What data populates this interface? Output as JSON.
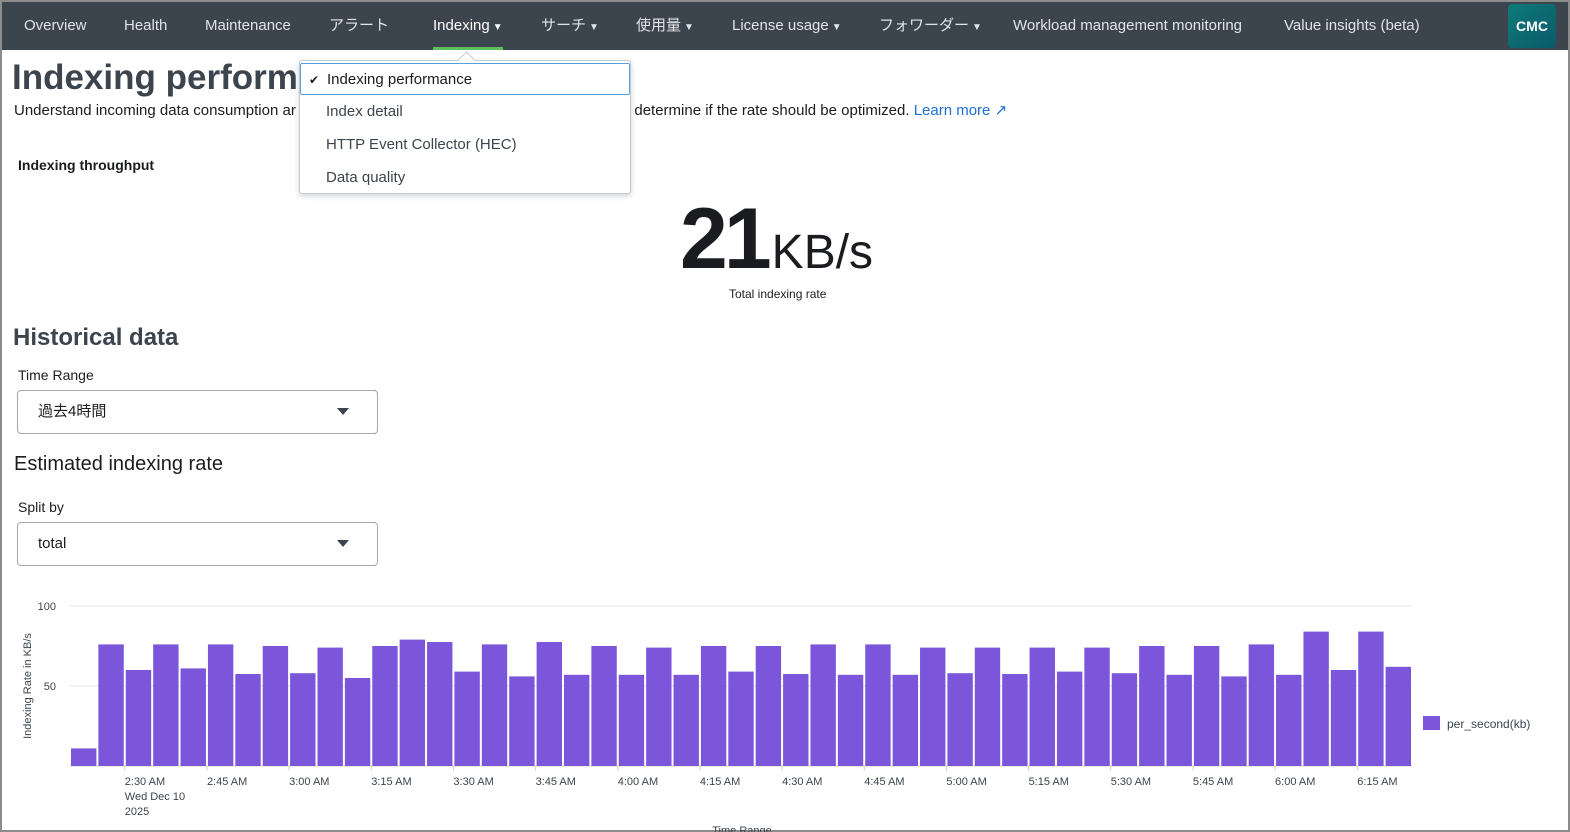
{
  "nav": {
    "items": [
      {
        "label": "Overview",
        "dropdown": false
      },
      {
        "label": "Health",
        "dropdown": false
      },
      {
        "label": "Maintenance",
        "dropdown": false
      },
      {
        "label": "アラート",
        "dropdown": false
      },
      {
        "label": "Indexing",
        "dropdown": true,
        "active": true
      },
      {
        "label": "サーチ",
        "dropdown": true
      },
      {
        "label": "使用量",
        "dropdown": true
      },
      {
        "label": "License usage",
        "dropdown": true
      },
      {
        "label": "フォワーダー",
        "dropdown": true
      },
      {
        "label": "Workload management monitoring",
        "dropdown": false
      },
      {
        "label": "Value insights (beta)",
        "dropdown": false
      }
    ],
    "logo": "CMC"
  },
  "menu": {
    "items": [
      "Indexing performance",
      "Index detail",
      "HTTP Event Collector (HEC)",
      "Data quality"
    ],
    "selected": "Indexing performance"
  },
  "page": {
    "title": "Indexing performance",
    "desc_start": "Understand incoming data consumption ar",
    "desc_end": "o determine if the rate should be optimized.",
    "learn_more": "Learn more"
  },
  "throughput": {
    "label": "Indexing throughput",
    "value": "21",
    "unit": "KB/s",
    "caption": "Total indexing rate"
  },
  "historical": {
    "title": "Historical data",
    "time_range_label": "Time Range",
    "time_range_value": "過去4時間",
    "chart_title": "Estimated indexing rate",
    "split_label": "Split by",
    "split_value": "total"
  },
  "chart_data": {
    "type": "bar",
    "title": "Estimated indexing rate",
    "xlabel": "Time Range",
    "ylabel": "Indexing Rate in KB/s",
    "ylim": [
      0,
      100
    ],
    "yticks": [
      50,
      100
    ],
    "grid": true,
    "legend": "right",
    "series": [
      {
        "name": "per_second(kb)",
        "color": "#7b56db",
        "values": [
          11,
          76,
          60,
          76,
          61,
          76,
          57.5,
          75,
          58,
          74,
          55,
          75,
          79,
          77.5,
          59,
          76,
          56,
          77.5,
          57,
          75,
          57,
          74,
          57,
          75,
          59,
          75,
          57.5,
          76,
          57,
          76,
          57,
          74,
          58,
          74,
          57.5,
          74,
          59,
          74,
          58,
          75,
          57,
          75,
          56,
          76,
          57,
          84,
          60,
          84,
          62
        ]
      }
    ],
    "first_bar": "2:20 AM",
    "bar_interval_minutes": 5,
    "xticks": [
      "2:30 AM",
      "2:45 AM",
      "3:00 AM",
      "3:15 AM",
      "3:30 AM",
      "3:45 AM",
      "4:00 AM",
      "4:15 AM",
      "4:30 AM",
      "4:45 AM",
      "5:00 AM",
      "5:15 AM",
      "5:30 AM",
      "5:45 AM",
      "6:00 AM",
      "6:15 AM"
    ],
    "date_label": [
      "Wed Dec 10",
      "2025"
    ]
  }
}
